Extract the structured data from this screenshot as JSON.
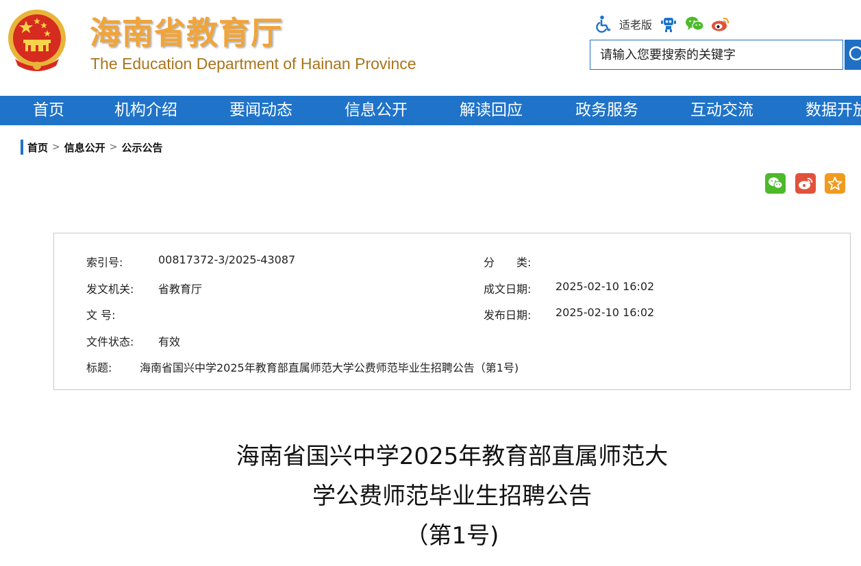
{
  "header": {
    "title": "海南省教育厅",
    "subtitle": "The Education Department of Hainan Province",
    "emblem_icon": "national-emblem-icon"
  },
  "tools": {
    "accessibility_icon": "wheelchair-icon",
    "elder_label": "适老版",
    "robot_icon": "robot-icon",
    "wechat_icon": "wechat-icon",
    "weibo_icon": "weibo-icon"
  },
  "search": {
    "placeholder": "请输入您要搜索的关键字",
    "value": "",
    "button_icon": "search-icon"
  },
  "nav": {
    "items": [
      "首页",
      "机构介绍",
      "要闻动态",
      "信息公开",
      "解读回应",
      "政务服务",
      "互动交流",
      "数据开放"
    ]
  },
  "breadcrumb": {
    "items": [
      "首页",
      "信息公开",
      "公示公告"
    ],
    "separator": ">"
  },
  "share": {
    "icons": [
      "wechat-share-icon",
      "weibo-share-icon",
      "favorite-star-icon"
    ]
  },
  "meta": {
    "index_label": "索引号:",
    "index_value": "00817372-3/2025-43087",
    "category_label": "分　　类:",
    "category_value": "",
    "issuer_label": "发文机关:",
    "issuer_value": "省教育厅",
    "created_label": "成文日期:",
    "created_value": "2025-02-10 16:02",
    "doc_no_label": "文  号:",
    "doc_no_value": "",
    "published_label": "发布日期:",
    "published_value": "2025-02-10 16:02",
    "status_label": "文件状态:",
    "status_value": "有效",
    "title_label": "标题:",
    "title_value": "海南省国兴中学2025年教育部直属师范大学公费师范毕业生招聘公告（第1号)"
  },
  "article": {
    "title_lines": [
      "海南省国兴中学2025年教育部直属师范大",
      "学公费师范毕业生招聘公告",
      "（第1号)"
    ]
  },
  "colors": {
    "nav_blue": "#1f73c9",
    "title_orange": "#f0a43a",
    "subtitle_brown": "#a9741b",
    "wechat_green": "#4cba2a",
    "weibo_red": "#e0523b",
    "favorite_orange": "#f19a1e"
  }
}
